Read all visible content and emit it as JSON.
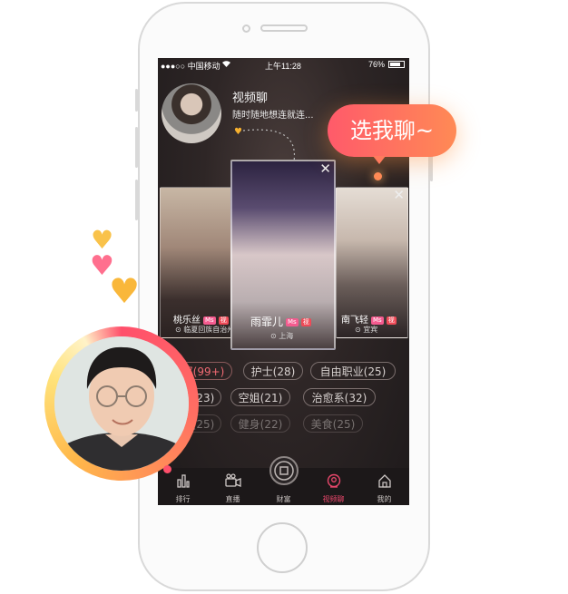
{
  "status_bar": {
    "carrier": "●●●○○ 中国移动",
    "time": "上午11:28",
    "battery": "76%"
  },
  "header": {
    "title": "视频聊",
    "subtitle": "随时随地想连就连..."
  },
  "cards": [
    {
      "name": "桃乐丝",
      "badge_ms": "Ms",
      "badge_v": "视",
      "location": "临夏回族自治州"
    },
    {
      "name": "雨霏儿",
      "badge_ms": "Ms",
      "badge_v": "视",
      "location": "上海"
    },
    {
      "name": "南飞轻",
      "badge_ms": "Ms",
      "badge_v": "视",
      "location": "宜宾"
    }
  ],
  "tags": [
    {
      "label": "全部(99+)",
      "active": true
    },
    {
      "label": "护士(28)"
    },
    {
      "label": "自由职业(25)"
    },
    {
      "label": "学生(23)"
    },
    {
      "label": "空姐(21)"
    },
    {
      "label": "治愈系(32)"
    },
    {
      "label": "模特(25)"
    },
    {
      "label": "健身(22)"
    },
    {
      "label": "美食(25)"
    }
  ],
  "tabbar": [
    {
      "label": "排行",
      "icon": "bar-chart-icon"
    },
    {
      "label": "直播",
      "icon": "video-camera-icon"
    },
    {
      "label": "财富",
      "icon": "wealth-icon"
    },
    {
      "label": "视频聊",
      "icon": "video-chat-icon",
      "active": true
    },
    {
      "label": "我的",
      "icon": "home-icon"
    }
  ],
  "bubble_text": "选我聊~",
  "colors": {
    "accent": "#e8476b",
    "bubble_start": "#ff5a6a",
    "bubble_end": "#ff8a55",
    "heart_orange": "#f7b12f",
    "heart_pink": "#ff6a8a"
  }
}
